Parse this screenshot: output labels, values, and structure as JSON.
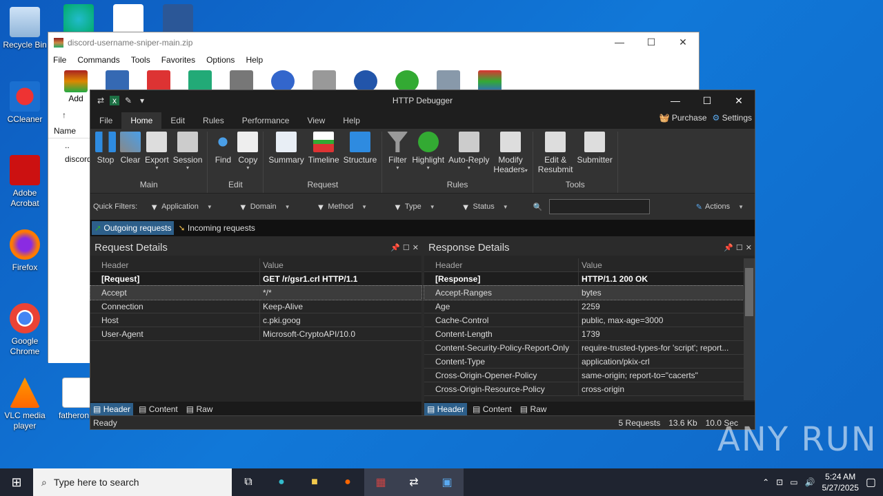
{
  "desktop": {
    "icons": [
      {
        "name": "recycle-bin",
        "label": "Recycle Bin"
      },
      {
        "name": "ccleaner",
        "label": "CCleaner"
      },
      {
        "name": "adobe-acrobat",
        "label": "Adobe Acrobat"
      },
      {
        "name": "firefox",
        "label": "Firefox"
      },
      {
        "name": "google-chrome",
        "label": "Google Chrome"
      },
      {
        "name": "vlc",
        "label": "VLC media player"
      },
      {
        "name": "fatheron",
        "label": "fatheron.p"
      }
    ]
  },
  "winrar": {
    "title": "discord-username-sniper-main.zip",
    "menu": [
      "File",
      "Commands",
      "Tools",
      "Favorites",
      "Options",
      "Help"
    ],
    "add_label": "Add",
    "name_col": "Name",
    "rows": [
      "..",
      "discord"
    ]
  },
  "hd": {
    "title": "HTTP Debugger",
    "tabs": [
      "File",
      "Home",
      "Edit",
      "Rules",
      "Performance",
      "View",
      "Help"
    ],
    "active_tab": "Home",
    "purchase": "Purchase",
    "settings": "Settings",
    "ribbon": {
      "main": {
        "label": "Main",
        "stop": "Stop",
        "clear": "Clear",
        "export": "Export",
        "session": "Session"
      },
      "edit": {
        "label": "Edit",
        "find": "Find",
        "copy": "Copy"
      },
      "request": {
        "label": "Request",
        "summary": "Summary",
        "timeline": "Timeline",
        "structure": "Structure"
      },
      "rules": {
        "label": "Rules",
        "filter": "Filter",
        "highlight": "Highlight",
        "autoreply": "Auto-Reply",
        "modify1": "Modify",
        "modify2": "Headers"
      },
      "tools": {
        "label": "Tools",
        "edit1": "Edit &",
        "edit2": "Resubmit",
        "submitter": "Submitter"
      }
    },
    "quick_filters": {
      "label": "Quick Filters:",
      "application": "Application",
      "domain": "Domain",
      "method": "Method",
      "type": "Type",
      "status": "Status",
      "actions": "Actions"
    },
    "req_tabs": {
      "outgoing": "Outgoing requests",
      "incoming": "Incoming requests"
    },
    "request_details": {
      "title": "Request Details",
      "col_header": "Header",
      "col_value": "Value",
      "rows": [
        {
          "h": "[Request]",
          "v": "GET /r/gsr1.crl HTTP/1.1"
        },
        {
          "h": "Accept",
          "v": "*/*"
        },
        {
          "h": "Connection",
          "v": "Keep-Alive"
        },
        {
          "h": "Host",
          "v": "c.pki.goog"
        },
        {
          "h": "User-Agent",
          "v": "Microsoft-CryptoAPI/10.0"
        }
      ]
    },
    "response_details": {
      "title": "Response Details",
      "col_header": "Header",
      "col_value": "Value",
      "rows": [
        {
          "h": "[Response]",
          "v": "HTTP/1.1 200 OK"
        },
        {
          "h": "Accept-Ranges",
          "v": "bytes"
        },
        {
          "h": "Age",
          "v": "2259"
        },
        {
          "h": "Cache-Control",
          "v": "public, max-age=3000"
        },
        {
          "h": "Content-Length",
          "v": "1739"
        },
        {
          "h": "Content-Security-Policy-Report-Only",
          "v": "require-trusted-types-for 'script'; report..."
        },
        {
          "h": "Content-Type",
          "v": "application/pkix-crl"
        },
        {
          "h": "Cross-Origin-Opener-Policy",
          "v": "same-origin; report-to=\"cacerts\""
        },
        {
          "h": "Cross-Origin-Resource-Policy",
          "v": "cross-origin"
        }
      ]
    },
    "bottom_tabs": {
      "header": "Header",
      "content": "Content",
      "raw": "Raw"
    },
    "status": {
      "ready": "Ready",
      "requests": "5 Requests",
      "size": "13.6 Kb",
      "time": "10.0 Sec"
    }
  },
  "taskbar": {
    "search_placeholder": "Type here to search",
    "time": "5:24 AM",
    "date": "5/27/2025"
  },
  "watermark": "ANY RUN"
}
